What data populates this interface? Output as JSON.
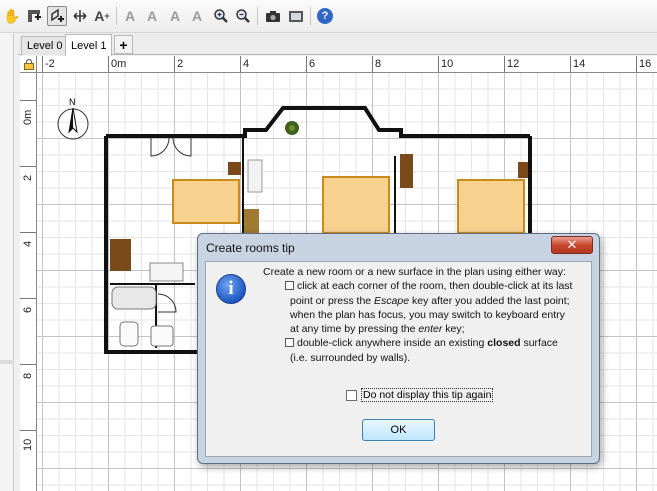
{
  "toolbar": {
    "icons": [
      "pan-icon",
      "create-walls-icon",
      "create-rooms-icon",
      "create-dimensions-icon",
      "add-text-icon",
      "rotate-text-icon",
      "modify-text-icon",
      "increase-text-size-icon",
      "decrease-text-size-icon",
      "zoom-in-icon",
      "zoom-out-icon",
      "create-photo-icon",
      "create-video-icon",
      "help-icon"
    ],
    "active_tool": "create-rooms-icon",
    "help_label": "?"
  },
  "levels": {
    "tabs": [
      "Level 0",
      "Level 1"
    ],
    "selected": "Level 1",
    "add_label": "+"
  },
  "ruler": {
    "top_labels": [
      "-2",
      "0m",
      "2",
      "4",
      "6",
      "8",
      "10",
      "12",
      "14",
      "16"
    ],
    "left_labels": [
      "0m",
      "2",
      "4",
      "6",
      "8",
      "10"
    ]
  },
  "plan": {
    "compass": "N",
    "wall_color": "#000000",
    "bed_color": "#f7d18e",
    "furniture_color": "#7a4a1a"
  },
  "dialog": {
    "title": "Create rooms tip",
    "close_label": "✕",
    "info_symbol": "i",
    "lines": [
      "Create a new room or a new surface in the plan using either way:",
      "click at each corner of the room, then double-click at its last",
      "point or press the ",
      "Escape",
      " key after you added the last point;",
      "when the plan has focus, you may switch to keyboard entry",
      "at any time by pressing the ",
      "enter",
      " key;",
      "double-click anywhere inside an existing ",
      "closed",
      " surface",
      "(i.e. surrounded by walls)."
    ],
    "dont_show": "Do not display this tip again",
    "ok_label": "OK"
  }
}
